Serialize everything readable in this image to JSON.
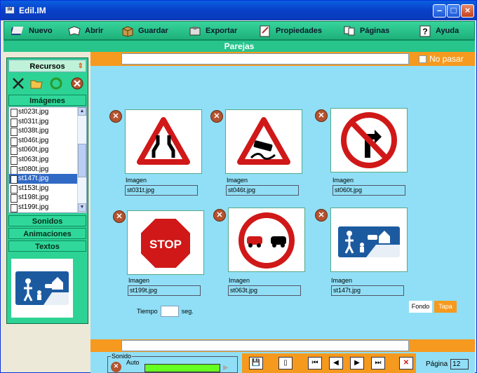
{
  "window": {
    "title": "Edil.IM",
    "app_icon": "IM"
  },
  "toolbar": {
    "nuevo": "Nuevo",
    "abrir": "Abrir",
    "guardar": "Guardar",
    "exportar": "Exportar",
    "propiedades": "Propiedades",
    "paginas": "Páginas",
    "ayuda": "Ayuda"
  },
  "section_title": "Parejas",
  "left": {
    "recursos": "Recursos",
    "imagenes": "Imágenes",
    "files": [
      "st023t.jpg",
      "st031t.jpg",
      "st038t.jpg",
      "st046t.jpg",
      "st060t.jpg",
      "st063t.jpg",
      "st080t.jpg",
      "st147t.jpg",
      "st153t.jpg",
      "st198t.jpg",
      "st199t.jpg"
    ],
    "selected_file": "st147t.jpg",
    "sonidos": "Sonidos",
    "animaciones": "Animaciones",
    "textos": "Textos"
  },
  "main": {
    "no_pasar": "No pasar",
    "cards": [
      {
        "label": "Imagen",
        "file": "st031t.jpg",
        "sign": "road-narrows-sign"
      },
      {
        "label": "Imagen",
        "file": "st046t.jpg",
        "sign": "slippery-road-sign"
      },
      {
        "label": "Imagen",
        "file": "st060t.jpg",
        "sign": "no-right-turn-sign"
      },
      {
        "label": "Imagen",
        "file": "st199t.jpg",
        "sign": "stop-sign"
      },
      {
        "label": "Imagen",
        "file": "st063t.jpg",
        "sign": "no-overtaking-sign"
      },
      {
        "label": "Imagen",
        "file": "st147t.jpg",
        "sign": "residential-zone-sign"
      }
    ],
    "stop_text": "STOP",
    "tiempo": "Tiempo",
    "seg": "seg.",
    "fondo": "Fondo",
    "tapa": "Tapa"
  },
  "bottom": {
    "sonido": "Sonido",
    "auto": "Auto",
    "pagina_label": "Página",
    "pagina_value": "12"
  },
  "colors": {
    "accent_orange": "#f59a1e",
    "panel_green": "#2dd394",
    "main_bg": "#90dff6",
    "title_blue": "#0a5fe0"
  }
}
